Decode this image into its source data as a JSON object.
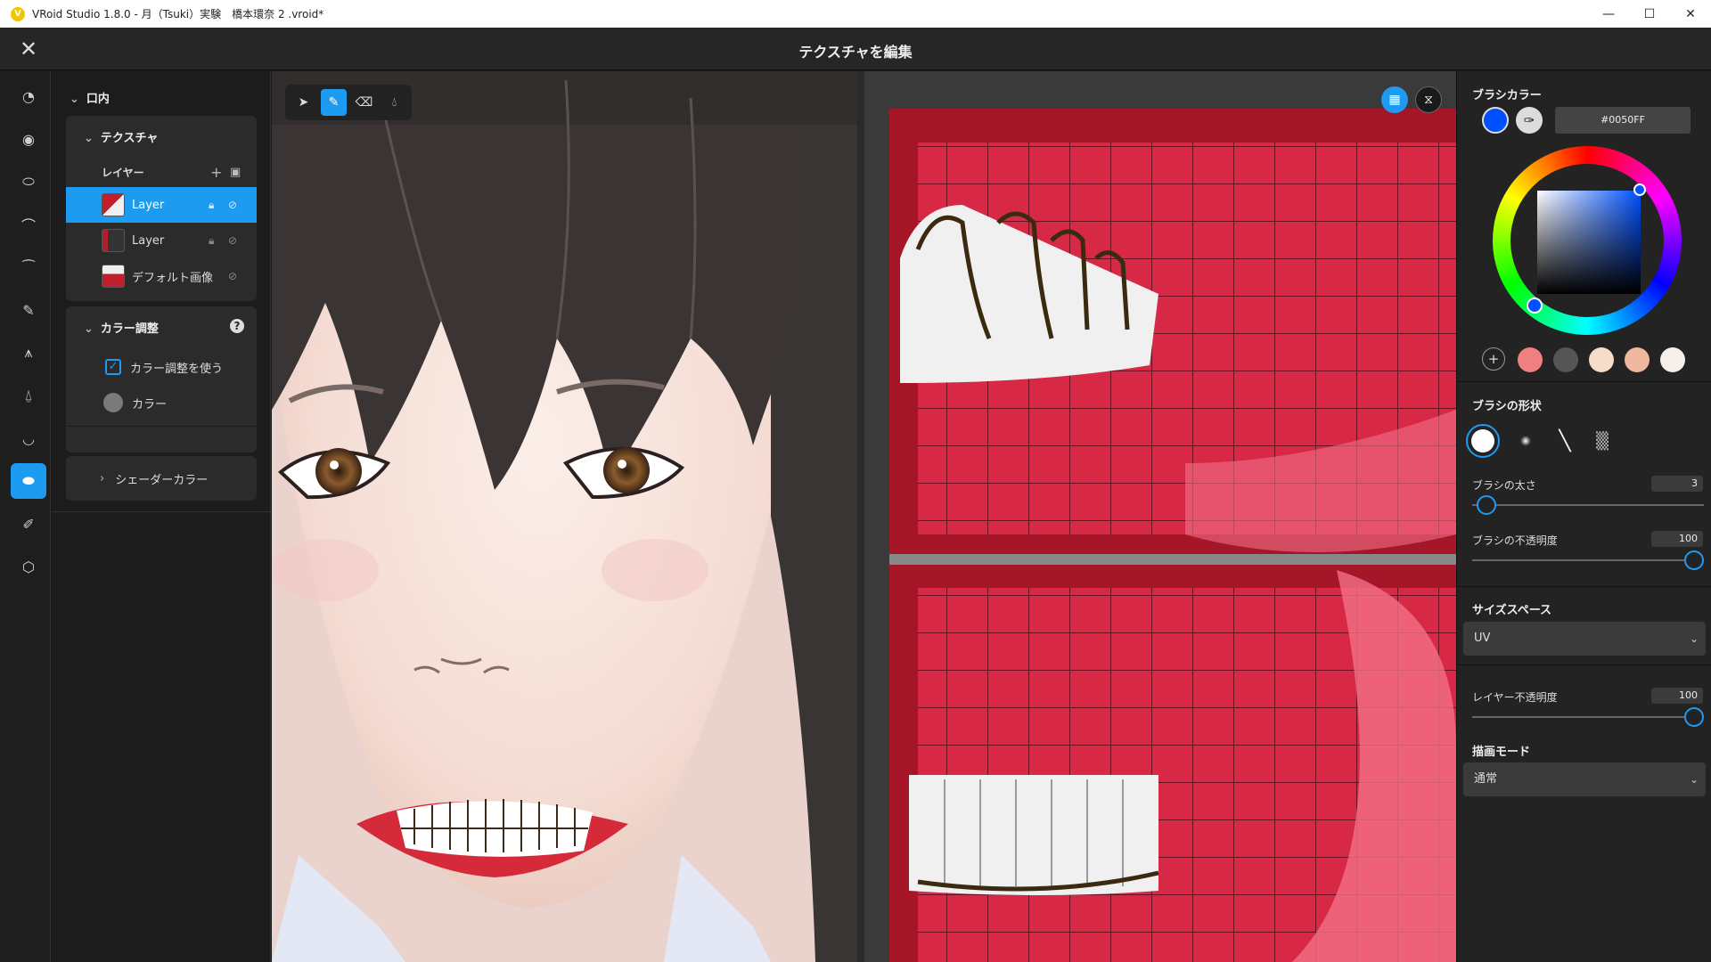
{
  "window": {
    "title": "VRoid Studio 1.8.0 - 月（Tsuki）実験　橋本環奈 2 .vroid*",
    "minimize": "—",
    "maximize": "☐",
    "close": "✕"
  },
  "header": {
    "title": "テクスチャを編集",
    "close": "✕"
  },
  "panel": {
    "section": "口内",
    "texture": {
      "title": "テクスチャ",
      "layers_header": "レイヤー",
      "layers": [
        {
          "name": "Layer",
          "selected": true
        },
        {
          "name": "Layer",
          "selected": false
        },
        {
          "name": "デフォルト画像",
          "selected": false
        }
      ]
    },
    "color_adjust": {
      "title": "カラー調整",
      "use_label": "カラー調整を使う",
      "use_checked": true,
      "color_label": "カラー"
    },
    "shader_color": "シェーダーカラー"
  },
  "right": {
    "brush_color_title": "ブラシカラー",
    "brush_color_hex": "#0050FF",
    "brush_color": "#0050ff",
    "presets": [
      "#f08080",
      "#555555",
      "#f7dcc8",
      "#f0b8a0",
      "#f7f0ea"
    ],
    "brush_shape_title": "ブラシの形状",
    "brush_size_label": "ブラシの太さ",
    "brush_size": "3",
    "brush_size_frac": 0.02,
    "brush_opacity_label": "ブラシの不透明度",
    "brush_opacity": "100",
    "brush_opacity_frac": 1.0,
    "size_space_title": "サイズスペース",
    "size_space_value": "UV",
    "layer_opacity_label": "レイヤー不透明度",
    "layer_opacity": "100",
    "layer_opacity_frac": 1.0,
    "draw_mode_title": "描画モード",
    "draw_mode_value": "通常"
  }
}
